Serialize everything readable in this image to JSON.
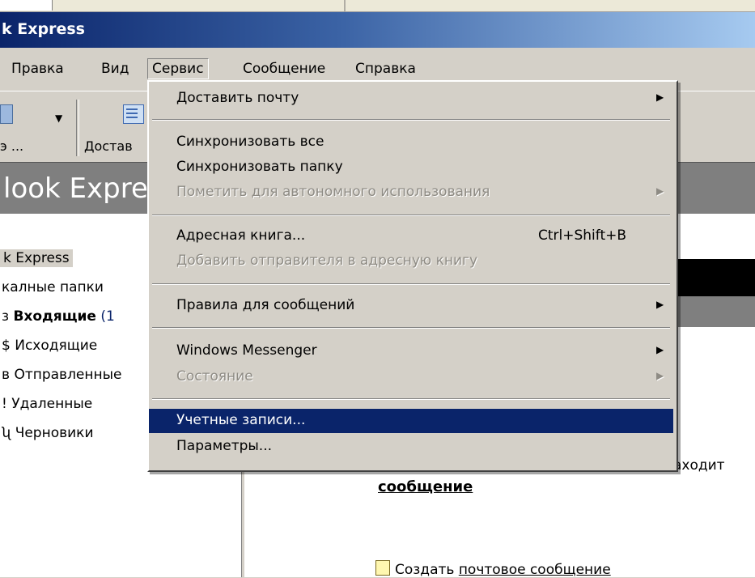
{
  "window": {
    "title": "k Express"
  },
  "menubar": {
    "items": [
      "Правка",
      "Вид",
      "Сервис",
      "Сообщение",
      "Справка"
    ]
  },
  "toolbar": {
    "button1_label": "э ...",
    "button2_label": "Достав"
  },
  "header": {
    "title": "look Expre"
  },
  "folders": {
    "root": "k Express",
    "local": "калные папки",
    "items": [
      {
        "name": "Входящие",
        "count": "(1",
        "prefix": "з"
      },
      {
        "name": "Исходящие",
        "prefix": "$"
      },
      {
        "name": "Отправленные",
        "prefix": "в"
      },
      {
        "name": "Удаленные",
        "prefix": "!"
      },
      {
        "name": "Черновики",
        "prefix": "ʯ"
      }
    ]
  },
  "content": {
    "partial_text": "аходит",
    "message_link": "сообщение",
    "create_prefix": "Создать",
    "create_link": "почтовое сообщение"
  },
  "dropdown": {
    "items": [
      {
        "label": "Доставить почту",
        "submenu": true,
        "disabled": false
      },
      {
        "label": "Синхронизовать все",
        "disabled": false
      },
      {
        "label": "Синхронизовать папку",
        "disabled": false
      },
      {
        "label": "Пометить для автономного использования",
        "submenu": true,
        "disabled": true
      },
      {
        "label": "Адресная книга...",
        "shortcut": "Ctrl+Shift+B",
        "disabled": false
      },
      {
        "label": "Добавить отправителя в адресную книгу",
        "disabled": true
      },
      {
        "label": "Правила для сообщений",
        "submenu": true,
        "disabled": false
      },
      {
        "label": "Windows Messenger",
        "submenu": true,
        "disabled": false
      },
      {
        "label": "Состояние",
        "submenu": true,
        "disabled": true
      },
      {
        "label": "Учетные записи...",
        "disabled": false,
        "highlighted": true
      },
      {
        "label": "Параметры...",
        "disabled": false
      }
    ]
  },
  "colors": {
    "title_bar": "#0a246a",
    "highlight": "#0a246a",
    "menu_bg": "#d4d0c8"
  }
}
